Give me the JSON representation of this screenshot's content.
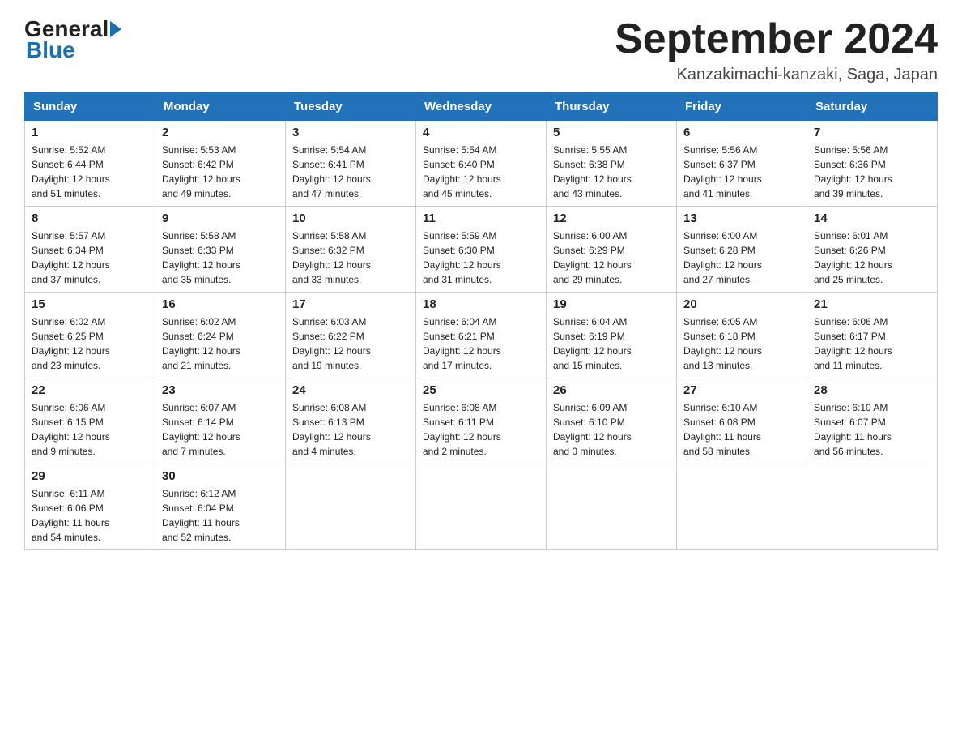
{
  "header": {
    "logo_general": "General",
    "logo_blue": "Blue",
    "month_title": "September 2024",
    "location": "Kanzakimachi-kanzaki, Saga, Japan"
  },
  "weekdays": [
    "Sunday",
    "Monday",
    "Tuesday",
    "Wednesday",
    "Thursday",
    "Friday",
    "Saturday"
  ],
  "weeks": [
    [
      {
        "day": "1",
        "sunrise": "5:52 AM",
        "sunset": "6:44 PM",
        "daylight": "12 hours and 51 minutes."
      },
      {
        "day": "2",
        "sunrise": "5:53 AM",
        "sunset": "6:42 PM",
        "daylight": "12 hours and 49 minutes."
      },
      {
        "day": "3",
        "sunrise": "5:54 AM",
        "sunset": "6:41 PM",
        "daylight": "12 hours and 47 minutes."
      },
      {
        "day": "4",
        "sunrise": "5:54 AM",
        "sunset": "6:40 PM",
        "daylight": "12 hours and 45 minutes."
      },
      {
        "day": "5",
        "sunrise": "5:55 AM",
        "sunset": "6:38 PM",
        "daylight": "12 hours and 43 minutes."
      },
      {
        "day": "6",
        "sunrise": "5:56 AM",
        "sunset": "6:37 PM",
        "daylight": "12 hours and 41 minutes."
      },
      {
        "day": "7",
        "sunrise": "5:56 AM",
        "sunset": "6:36 PM",
        "daylight": "12 hours and 39 minutes."
      }
    ],
    [
      {
        "day": "8",
        "sunrise": "5:57 AM",
        "sunset": "6:34 PM",
        "daylight": "12 hours and 37 minutes."
      },
      {
        "day": "9",
        "sunrise": "5:58 AM",
        "sunset": "6:33 PM",
        "daylight": "12 hours and 35 minutes."
      },
      {
        "day": "10",
        "sunrise": "5:58 AM",
        "sunset": "6:32 PM",
        "daylight": "12 hours and 33 minutes."
      },
      {
        "day": "11",
        "sunrise": "5:59 AM",
        "sunset": "6:30 PM",
        "daylight": "12 hours and 31 minutes."
      },
      {
        "day": "12",
        "sunrise": "6:00 AM",
        "sunset": "6:29 PM",
        "daylight": "12 hours and 29 minutes."
      },
      {
        "day": "13",
        "sunrise": "6:00 AM",
        "sunset": "6:28 PM",
        "daylight": "12 hours and 27 minutes."
      },
      {
        "day": "14",
        "sunrise": "6:01 AM",
        "sunset": "6:26 PM",
        "daylight": "12 hours and 25 minutes."
      }
    ],
    [
      {
        "day": "15",
        "sunrise": "6:02 AM",
        "sunset": "6:25 PM",
        "daylight": "12 hours and 23 minutes."
      },
      {
        "day": "16",
        "sunrise": "6:02 AM",
        "sunset": "6:24 PM",
        "daylight": "12 hours and 21 minutes."
      },
      {
        "day": "17",
        "sunrise": "6:03 AM",
        "sunset": "6:22 PM",
        "daylight": "12 hours and 19 minutes."
      },
      {
        "day": "18",
        "sunrise": "6:04 AM",
        "sunset": "6:21 PM",
        "daylight": "12 hours and 17 minutes."
      },
      {
        "day": "19",
        "sunrise": "6:04 AM",
        "sunset": "6:19 PM",
        "daylight": "12 hours and 15 minutes."
      },
      {
        "day": "20",
        "sunrise": "6:05 AM",
        "sunset": "6:18 PM",
        "daylight": "12 hours and 13 minutes."
      },
      {
        "day": "21",
        "sunrise": "6:06 AM",
        "sunset": "6:17 PM",
        "daylight": "12 hours and 11 minutes."
      }
    ],
    [
      {
        "day": "22",
        "sunrise": "6:06 AM",
        "sunset": "6:15 PM",
        "daylight": "12 hours and 9 minutes."
      },
      {
        "day": "23",
        "sunrise": "6:07 AM",
        "sunset": "6:14 PM",
        "daylight": "12 hours and 7 minutes."
      },
      {
        "day": "24",
        "sunrise": "6:08 AM",
        "sunset": "6:13 PM",
        "daylight": "12 hours and 4 minutes."
      },
      {
        "day": "25",
        "sunrise": "6:08 AM",
        "sunset": "6:11 PM",
        "daylight": "12 hours and 2 minutes."
      },
      {
        "day": "26",
        "sunrise": "6:09 AM",
        "sunset": "6:10 PM",
        "daylight": "12 hours and 0 minutes."
      },
      {
        "day": "27",
        "sunrise": "6:10 AM",
        "sunset": "6:08 PM",
        "daylight": "11 hours and 58 minutes."
      },
      {
        "day": "28",
        "sunrise": "6:10 AM",
        "sunset": "6:07 PM",
        "daylight": "11 hours and 56 minutes."
      }
    ],
    [
      {
        "day": "29",
        "sunrise": "6:11 AM",
        "sunset": "6:06 PM",
        "daylight": "11 hours and 54 minutes."
      },
      {
        "day": "30",
        "sunrise": "6:12 AM",
        "sunset": "6:04 PM",
        "daylight": "11 hours and 52 minutes."
      },
      null,
      null,
      null,
      null,
      null
    ]
  ],
  "labels": {
    "sunrise": "Sunrise:",
    "sunset": "Sunset:",
    "daylight": "Daylight:"
  }
}
